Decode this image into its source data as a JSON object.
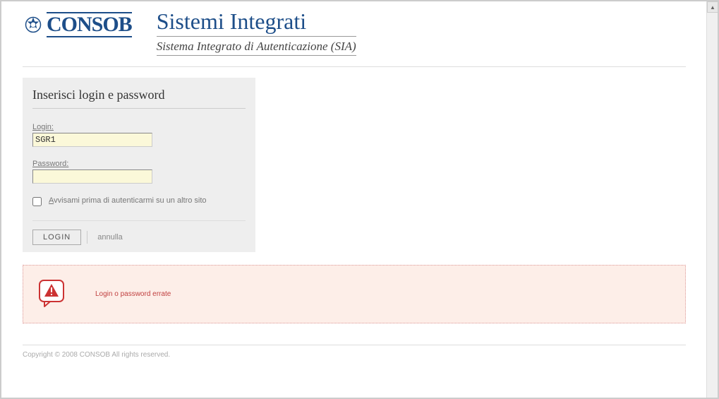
{
  "header": {
    "logo_text": "CONSOB",
    "main_title": "Sistemi Integrati",
    "sub_title": "Sistema Integrato di Autenticazione (SIA)"
  },
  "login_panel": {
    "heading": "Inserisci login e password",
    "login_label": "Login:",
    "login_value": "SGR1",
    "password_label": "Password:",
    "password_value": "",
    "warn_prefix": "A",
    "warn_rest": "vvisami prima di autenticarmi su un altro sito",
    "submit_label": "LOGIN",
    "cancel_label": "annulla"
  },
  "error": {
    "message": "Login o password errate"
  },
  "footer": {
    "text": "Copyright © 2008 CONSOB All rights reserved."
  }
}
